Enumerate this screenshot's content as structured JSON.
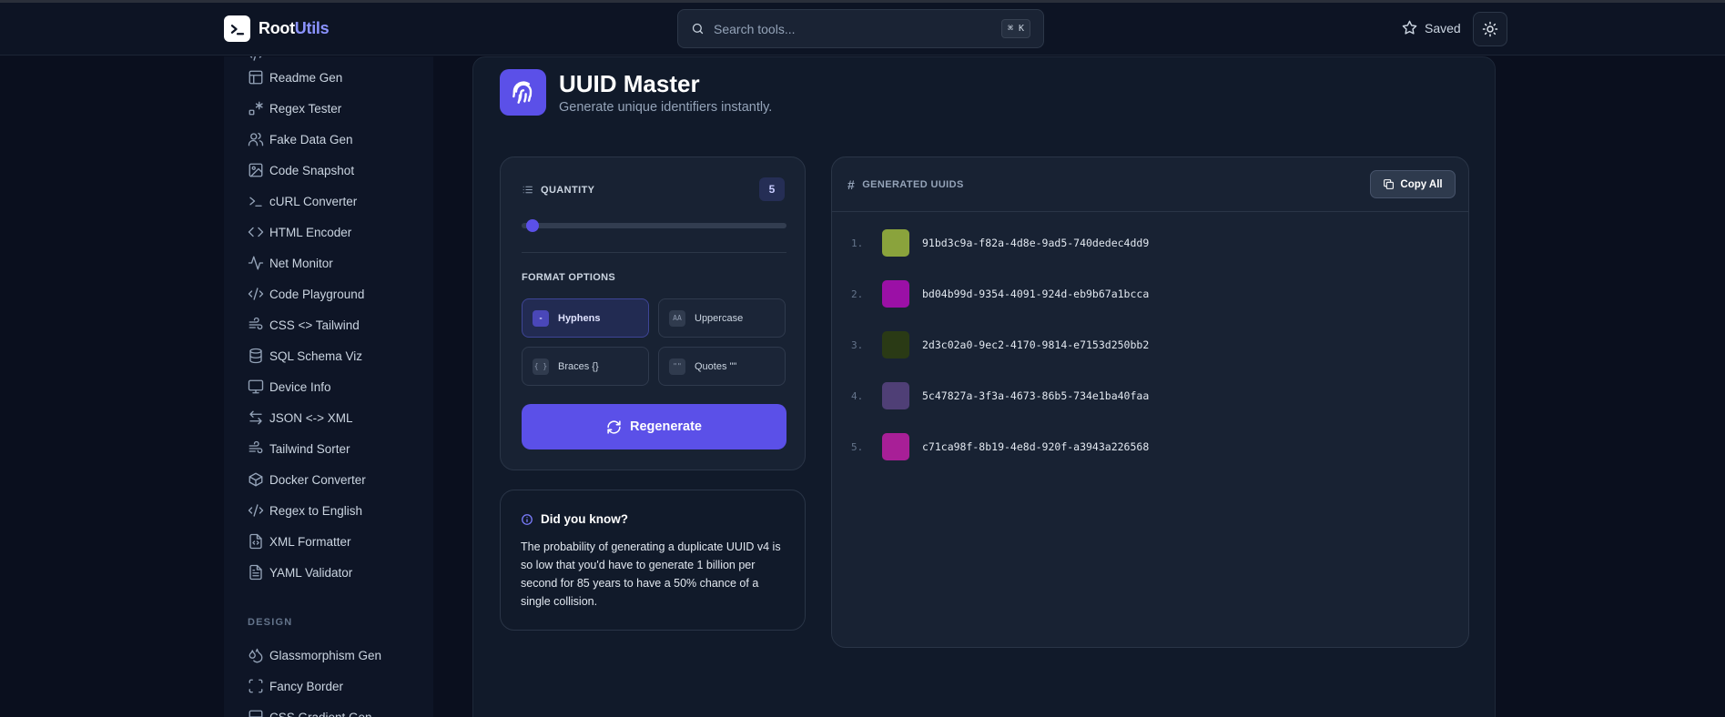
{
  "app": {
    "brand_main": "Root",
    "brand_accent": "Utils"
  },
  "search": {
    "placeholder": "Search tools...",
    "shortcut": "⌘ K"
  },
  "header": {
    "saved_label": "Saved"
  },
  "sidebar": {
    "items": [
      {
        "label": "Readme Gen",
        "icon": "layout-icon"
      },
      {
        "label": "Regex Tester",
        "icon": "regex-icon"
      },
      {
        "label": "Fake Data Gen",
        "icon": "users-icon"
      },
      {
        "label": "Code Snapshot",
        "icon": "image-icon"
      },
      {
        "label": "cURL Converter",
        "icon": "terminal-icon"
      },
      {
        "label": "HTML Encoder",
        "icon": "code-icon"
      },
      {
        "label": "Net Monitor",
        "icon": "activity-icon"
      },
      {
        "label": "Code Playground",
        "icon": "code-xml-icon"
      },
      {
        "label": "CSS <> Tailwind",
        "icon": "wind-icon"
      },
      {
        "label": "SQL Schema Viz",
        "icon": "database-icon"
      },
      {
        "label": "Device Info",
        "icon": "monitor-icon"
      },
      {
        "label": "JSON <-> XML",
        "icon": "arrows-icon"
      },
      {
        "label": "Tailwind Sorter",
        "icon": "wind-icon"
      },
      {
        "label": "Docker Converter",
        "icon": "box-icon"
      },
      {
        "label": "Regex to English",
        "icon": "code-xml-icon"
      },
      {
        "label": "XML Formatter",
        "icon": "file-code-icon"
      },
      {
        "label": "YAML Validator",
        "icon": "file-text-icon"
      }
    ],
    "section_design": "DESIGN",
    "design_items": [
      {
        "label": "Glassmorphism Gen",
        "icon": "droplets-icon"
      },
      {
        "label": "Fancy Border",
        "icon": "frame-icon"
      },
      {
        "label": "CSS Gradient Gen",
        "icon": "gradient-icon"
      }
    ]
  },
  "tool": {
    "title": "UUID Master",
    "subtitle": "Generate unique identifiers instantly.",
    "icon": "fingerprint-icon",
    "accent": "#5b50e8"
  },
  "controls": {
    "quantity_label": "QUANTITY",
    "quantity_value": "5",
    "quantity_fraction": 0.04,
    "format_label": "FORMAT OPTIONS",
    "options": [
      {
        "chip": "-",
        "label": "Hyphens",
        "active": true
      },
      {
        "chip": "AA",
        "label": "Uppercase",
        "active": false
      },
      {
        "chip": "{ }",
        "label": "Braces {}",
        "active": false
      },
      {
        "chip": "\"\"",
        "label": "Quotes \"\"",
        "active": false
      }
    ],
    "regenerate_label": "Regenerate"
  },
  "info": {
    "title": "Did you know?",
    "body": "The probability of generating a duplicate UUID v4 is so low that you'd have to generate 1 billion per second for 85 years to have a 50% chance of a single collision."
  },
  "uuids": {
    "header_label": "GENERATED UUIDS",
    "copy_all_label": "Copy All",
    "items": [
      {
        "num": "1.",
        "value": "91bd3c9a-f82a-4d8e-9ad5-740dedec4dd9",
        "color": "#8aa33c"
      },
      {
        "num": "2.",
        "value": "bd04b99d-9354-4091-924d-eb9b67a1bcca",
        "color": "#9b10a6"
      },
      {
        "num": "3.",
        "value": "2d3c02a0-9ec2-4170-9814-e7153d250bb2",
        "color": "#2a3a15"
      },
      {
        "num": "4.",
        "value": "5c47827a-3f3a-4673-86b5-734e1ba40faa",
        "color": "#4f3f76"
      },
      {
        "num": "5.",
        "value": "c71ca98f-8b19-4e8d-920f-a3943a226568",
        "color": "#a81f97"
      }
    ]
  }
}
